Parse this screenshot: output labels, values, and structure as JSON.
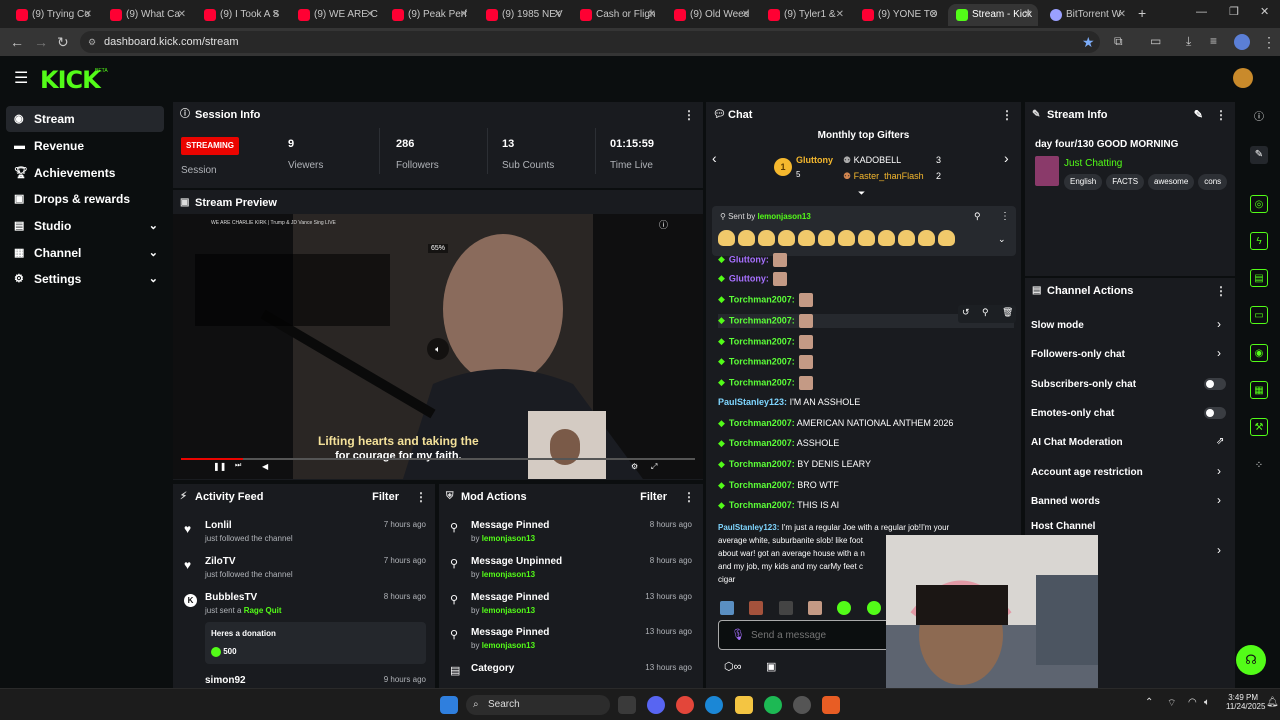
{
  "browser": {
    "tabs": [
      {
        "title": "(9) Trying Co",
        "active": false
      },
      {
        "title": "(9) What Ca",
        "active": false
      },
      {
        "title": "(9) I Took A S",
        "active": false
      },
      {
        "title": "(9) WE ARE C",
        "active": false
      },
      {
        "title": "(9) Peak Perf",
        "active": false
      },
      {
        "title": "(9) 1985 NEV",
        "active": false
      },
      {
        "title": "Cash or Fligh",
        "active": false
      },
      {
        "title": "(9) Old Weed",
        "active": false
      },
      {
        "title": "(9) Tyler1 & ",
        "active": false
      },
      {
        "title": "(9) YONE TO",
        "active": false
      },
      {
        "title": "Stream - Kick",
        "active": true
      },
      {
        "title": "BitTorrent W",
        "active": false
      }
    ],
    "url": "dashboard.kick.com/stream"
  },
  "brand": {
    "logo": "KICK",
    "beta": "BETA",
    "accent": "#53fc18"
  },
  "sidebar": {
    "items": [
      {
        "label": "Stream",
        "icon": "stream-icon",
        "active": true
      },
      {
        "label": "Revenue",
        "icon": "revenue-icon"
      },
      {
        "label": "Achievements",
        "icon": "trophy-icon"
      },
      {
        "label": "Drops & rewards",
        "icon": "gift-icon"
      },
      {
        "label": "Studio",
        "icon": "studio-icon",
        "expandable": true
      },
      {
        "label": "Channel",
        "icon": "channel-icon",
        "expandable": true
      },
      {
        "label": "Settings",
        "icon": "gear-icon",
        "expandable": true
      }
    ]
  },
  "session": {
    "title": "Session Info",
    "status": "STREAMING",
    "status_label": "Session",
    "stats": [
      {
        "value": "9",
        "label": "Viewers"
      },
      {
        "value": "286",
        "label": "Followers"
      },
      {
        "value": "13",
        "label": "Sub Counts"
      },
      {
        "value": "01:15:59",
        "label": "Time Live"
      }
    ]
  },
  "preview": {
    "title": "Stream Preview",
    "overlay_title": "WE ARE CHARLIE KIRK | Trump & JD Vance Sing LIVE",
    "zoom": "65%",
    "caption_line1": "Lifting hearts and taking the",
    "caption_line2": "for courage for my faith."
  },
  "activity": {
    "title": "Activity Feed",
    "filter": "Filter",
    "items": [
      {
        "name": "Lonlil",
        "text": "just followed the channel",
        "time": "7 hours ago",
        "icon": "heart-icon"
      },
      {
        "name": "ZiloTV",
        "text": "just followed the channel",
        "time": "7 hours ago",
        "icon": "heart-icon"
      },
      {
        "name": "BubblesTV",
        "text": "just sent a",
        "highlight": "Rage Quit",
        "time": "8 hours ago",
        "icon": "kick-icon",
        "message": "Heres a donation",
        "amount": "500"
      },
      {
        "name": "simon92",
        "text": "",
        "time": "9 hours ago",
        "icon": "heart-icon"
      }
    ]
  },
  "mod": {
    "title": "Mod Actions",
    "filter": "Filter",
    "items": [
      {
        "action": "Message Pinned",
        "by": "by",
        "user": "lemonjason13",
        "time": "8 hours ago",
        "icon": "pin-icon"
      },
      {
        "action": "Message Unpinned",
        "by": "by",
        "user": "lemonjason13",
        "time": "8 hours ago",
        "icon": "pin-icon"
      },
      {
        "action": "Message Pinned",
        "by": "by",
        "user": "lemonjason13",
        "time": "13 hours ago",
        "icon": "pin-icon"
      },
      {
        "action": "Message Pinned",
        "by": "by",
        "user": "lemonjason13",
        "time": "13 hours ago",
        "icon": "pin-icon"
      },
      {
        "action": "Category",
        "by": "",
        "user": "",
        "time": "13 hours ago",
        "icon": "category-icon"
      }
    ]
  },
  "chat": {
    "title": "Chat",
    "gifters_title": "Monthly top Gifters",
    "gifters": [
      {
        "name": "Gluttony",
        "count": "5",
        "rank": "1"
      },
      {
        "name": "KADOBELL",
        "count": "3"
      },
      {
        "name": "Faster_thanFlash",
        "count": "2"
      }
    ],
    "pinned_by_label": "Sent by",
    "pinned_by": "lemonjason13",
    "messages": [
      {
        "user": "Gluttony:",
        "text": "",
        "emote": true
      },
      {
        "user": "Gluttony:",
        "text": "",
        "emote": true
      },
      {
        "user": "Torchman2007:",
        "text": "",
        "emote": true
      },
      {
        "user": "Torchman2007:",
        "text": "",
        "emote": true
      },
      {
        "user": "Torchman2007:",
        "text": "",
        "emote": true
      },
      {
        "user": "Torchman2007:",
        "text": "",
        "emote": true
      },
      {
        "user": "Torchman2007:",
        "text": "",
        "emote": true
      },
      {
        "user": "PaulStanley123:",
        "text": "I'M AN ASSHOLE",
        "blue": true
      },
      {
        "user": "Torchman2007:",
        "text": "AMERICAN NATIONAL ANTHEM 2026"
      },
      {
        "user": "Torchman2007:",
        "text": "ASSHOLE"
      },
      {
        "user": "Torchman2007:",
        "text": "BY DENIS LEARY"
      },
      {
        "user": "Torchman2007:",
        "text": "BRO WTF"
      },
      {
        "user": "Torchman2007:",
        "text": "THIS IS AI"
      }
    ],
    "long_message": {
      "user": "PaulStanley123:",
      "line1": "I'm just a regular Joe with a regular job!I'm your",
      "line2": "average white, suburbanite slob! like foot",
      "line3": "about war! got an average house with a n",
      "line4": "and my job, my kids and my carMy feet c",
      "line5": "cigar"
    },
    "input_placeholder": "Send a message"
  },
  "stream_info": {
    "title": "Stream Info",
    "stream_title": "day four/130 GOOD MORNING",
    "category": "Just Chatting",
    "tags": [
      "English",
      "FACTS",
      "awesome",
      "cons"
    ]
  },
  "channel_actions": {
    "title": "Channel Actions",
    "items": [
      {
        "label": "Slow mode",
        "control": "chevron"
      },
      {
        "label": "Followers-only chat",
        "control": "chevron"
      },
      {
        "label": "Subscribers-only chat",
        "control": "toggle"
      },
      {
        "label": "Emotes-only chat",
        "control": "toggle"
      },
      {
        "label": "AI Chat Moderation",
        "control": "external"
      },
      {
        "label": "Account age restriction",
        "control": "chevron"
      },
      {
        "label": "Banned words",
        "control": "chevron"
      },
      {
        "label": "Host Channel",
        "control": "none"
      }
    ]
  },
  "taskbar": {
    "search": "Search",
    "time": "3:49 PM",
    "date": "11/24/2025"
  }
}
